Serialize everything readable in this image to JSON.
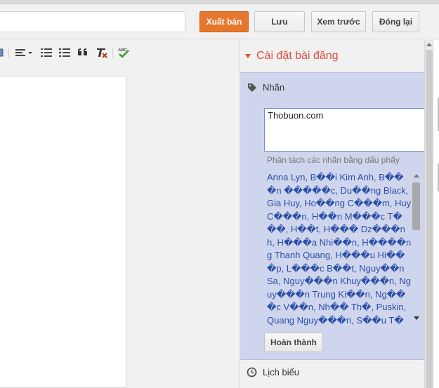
{
  "header": {
    "publish_label": "Xuất bản",
    "save_label": "Lưu",
    "preview_label": "Xem trước",
    "close_label": "Đóng lại"
  },
  "toolbar": {
    "icons": [
      "image-icon",
      "align-icon",
      "numbered-list-icon",
      "bulleted-list-icon",
      "quote-icon",
      "clear-formatting-icon",
      "spellcheck-icon"
    ]
  },
  "sidebar": {
    "title": "Cài đặt bài đăng",
    "labels": {
      "heading": "Nhãn",
      "input_value": "Thobuon.com",
      "hint": "Phân tách các nhãn bằng dấu phẩy",
      "suggestions_text": "Anna Lyn, B��i Kim Anh, B���n �����c, Du��ng Black, Gia Huy, Ho��ng C���m, Huy C���n, H��n M���c T���, H��t, H��� Dz���nh, H���a Nhi��n, H����ng Thanh Quang, H���u Hi���p, L���c B��t, Nguy��n Sa, Nguy���n Khuy���n, Nguy���n Trung Ki��n, Ng���c V��n, Nh�� Th�, Puskin, Quang Nguy���n, S��u T���m, S������u T����������m, Thanh T���ng, Thanh",
      "done_label": "Hoàn thành"
    },
    "schedule_label": "Lịch biểu"
  },
  "colors": {
    "accent": "#dd4b39",
    "publish": "#e8772e",
    "labels_panel": "#cfd5ec",
    "link": "#2a4fa8"
  }
}
